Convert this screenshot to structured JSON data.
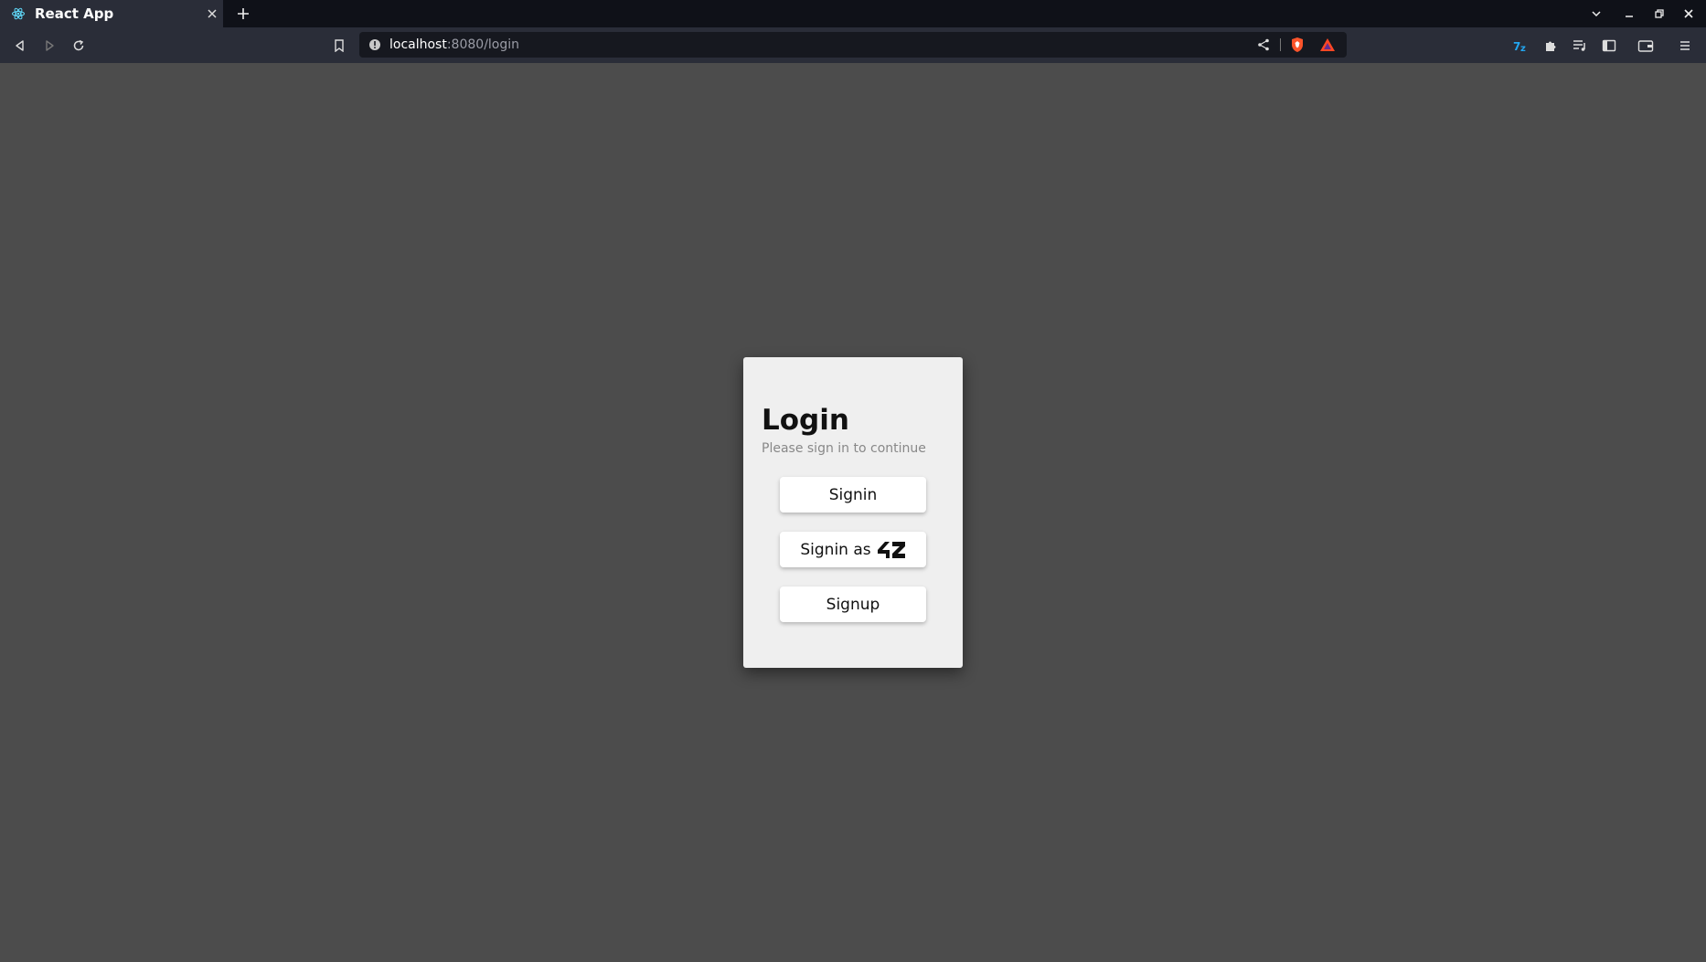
{
  "browser": {
    "tab": {
      "title": "React App",
      "favicon": "react-icon"
    },
    "url": {
      "host": "localhost",
      "rest": ":8080/login"
    },
    "colors": {
      "chrome_bg": "#0f1118",
      "toolbar_bg": "#2a2d38",
      "urlbar_bg": "#16181f",
      "page_bg": "#4c4c4c"
    }
  },
  "login": {
    "title": "Login",
    "subtitle": "Please sign in to continue",
    "signin_label": "Signin",
    "signin42_label": "Signin as",
    "signin42_logo": "42-logo",
    "signup_label": "Signup",
    "colors": {
      "card_bg": "#efefef",
      "button_bg": "#ffffff"
    }
  }
}
